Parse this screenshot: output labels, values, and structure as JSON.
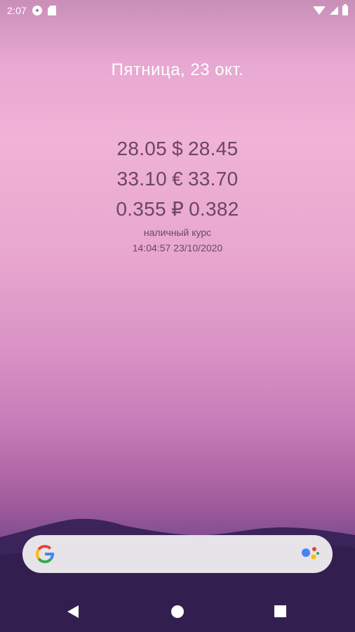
{
  "status_bar": {
    "time": "2:07",
    "icons": [
      "app-notification-icon",
      "sd-card-icon",
      "wifi-icon",
      "cell-signal-icon",
      "battery-icon"
    ]
  },
  "date": "Пятница, 23 окт.",
  "rates": [
    {
      "buy": "28.05",
      "symbol": "$",
      "sell": "28.45"
    },
    {
      "buy": "33.10",
      "symbol": "€",
      "sell": "33.70"
    },
    {
      "buy": "0.355",
      "symbol": "₽",
      "sell": "0.382"
    }
  ],
  "rate_note": "наличный курс",
  "rate_updated": "14:04:57 23/10/2020",
  "search": {
    "logo": "google-g-icon",
    "assistant": "google-assistant-icon"
  },
  "nav": {
    "back": "back-icon",
    "home": "home-icon",
    "recents": "recents-icon"
  },
  "colors": {
    "accent_text": "#6b4660",
    "search_bg": "#e6e3e9"
  }
}
